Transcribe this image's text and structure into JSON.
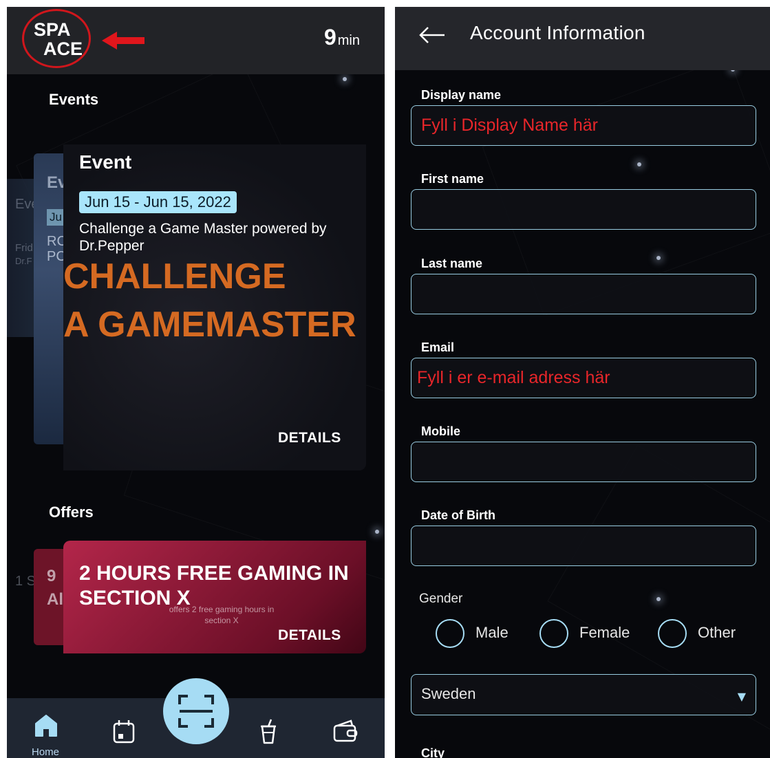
{
  "left": {
    "logo": {
      "line1": "SPA",
      "line2": "ACE"
    },
    "timer": {
      "value": "9",
      "unit": "min"
    },
    "events_heading": "Events",
    "event_card": {
      "type_label": "Event",
      "date": "Jun 15 - Jun 15, 2022",
      "description": "Challenge a Game Master powered by Dr.Pepper",
      "banner_line1": "CHALLENGE",
      "banner_line2": "A GAMEMASTER",
      "details_label": "DETAILS"
    },
    "ghost_text": {
      "ev": "Ev",
      "ev2": "Eve",
      "ju": "Ju",
      "rc": "RC",
      "pc": "PC",
      "frid": "Frid",
      "drf": "Dr.F",
      "ones": "1 S",
      "nine": "9",
      "al": "Al"
    },
    "offers_heading": "Offers",
    "offer_card": {
      "title": "2 HOURS FREE GAMING IN SECTION X",
      "subtitle": "offers 2 free gaming hours in section X",
      "details_label": "DETAILS"
    },
    "nav": {
      "home_label": "Home",
      "items": [
        "home-icon",
        "calendar-icon",
        "scan-icon",
        "drink-icon",
        "wallet-icon"
      ]
    },
    "colors": {
      "accent": "#a6dcf4",
      "logo_ring": "#d0161c",
      "banner": "#d56a22",
      "offer": "#b3264a"
    }
  },
  "right": {
    "title": "Account Information",
    "fields": {
      "display_name": {
        "label": "Display name",
        "value": "Fyll i Display Name här"
      },
      "first_name": {
        "label": "First name",
        "value": ""
      },
      "last_name": {
        "label": "Last name",
        "value": ""
      },
      "email": {
        "label": "Email",
        "value": "Fyll i er e-mail adress här"
      },
      "mobile": {
        "label": "Mobile",
        "value": ""
      },
      "dob": {
        "label": "Date of Birth",
        "value": ""
      }
    },
    "gender": {
      "label": "Gender",
      "options": [
        "Male",
        "Female",
        "Other"
      ]
    },
    "country": {
      "value": "Sweden"
    },
    "city_label": "City",
    "colors": {
      "field_border": "#99cde2",
      "annotation_text": "#e8262a"
    }
  }
}
